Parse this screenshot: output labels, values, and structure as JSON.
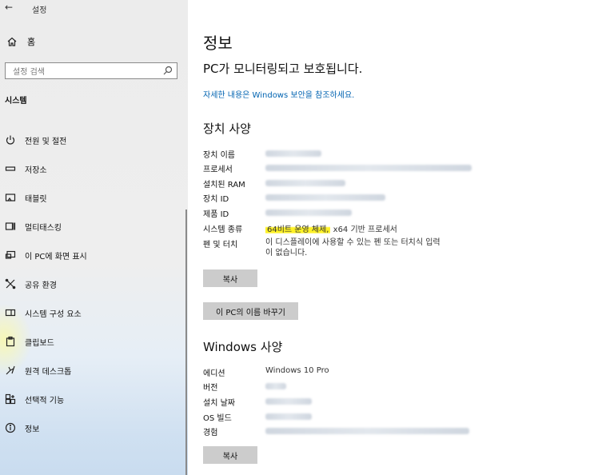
{
  "window": {
    "title": "설정",
    "back_icon": "back-arrow-icon"
  },
  "sidebar": {
    "home_label": "홈",
    "search_placeholder": "설정 검색",
    "section_title": "시스템",
    "items": [
      {
        "label": "전원 및 절전",
        "icon": "power-icon"
      },
      {
        "label": "저장소",
        "icon": "storage-icon"
      },
      {
        "label": "태블릿",
        "icon": "tablet-icon"
      },
      {
        "label": "멀티태스킹",
        "icon": "multitasking-icon"
      },
      {
        "label": "이 PC에 화면 표시",
        "icon": "project-icon"
      },
      {
        "label": "공유 환경",
        "icon": "shared-icon"
      },
      {
        "label": "시스템 구성 요소",
        "icon": "components-icon"
      },
      {
        "label": "클립보드",
        "icon": "clipboard-icon"
      },
      {
        "label": "원격 데스크톱",
        "icon": "remote-desktop-icon"
      },
      {
        "label": "선택적 기능",
        "icon": "optional-features-icon"
      },
      {
        "label": "정보",
        "icon": "info-icon"
      }
    ]
  },
  "main": {
    "title": "정보",
    "protection_status": "PC가 모니터링되고 보호됩니다.",
    "security_link": "자세한 내용은 Windows 보안을 참조하세요.",
    "device_specs": {
      "heading": "장치 사양",
      "rows": [
        {
          "label": "장치 이름",
          "value": "",
          "blurred": true
        },
        {
          "label": "프로세서",
          "value": "",
          "blurred": true
        },
        {
          "label": "설치된 RAM",
          "value": "",
          "blurred": true
        },
        {
          "label": "장치 ID",
          "value": "",
          "blurred": true
        },
        {
          "label": "제품 ID",
          "value": "",
          "blurred": true
        },
        {
          "label": "시스템 종류",
          "value_highlight": "64비트 운영 체제,",
          "value_rest": " x64 기반 프로세서"
        },
        {
          "label": "펜 및 터치",
          "value_line1": "이 디스플레이에 사용할 수 있는 펜 또는 터치식 입력",
          "value_line2": "이 없습니다."
        }
      ],
      "copy_button": "복사",
      "rename_button": "이 PC의 이름 바꾸기"
    },
    "windows_specs": {
      "heading": "Windows 사양",
      "rows": [
        {
          "label": "에디션",
          "value": "Windows 10 Pro"
        },
        {
          "label": "버전",
          "value": "",
          "blurred": true
        },
        {
          "label": "설치 날짜",
          "value": "",
          "blurred": true
        },
        {
          "label": "OS 빌드",
          "value": "",
          "blurred": true
        },
        {
          "label": "경험",
          "value": "",
          "blurred": true
        }
      ],
      "copy_button": "복사"
    }
  },
  "colors": {
    "link": "#0063b1",
    "highlight": "#fff000",
    "button_bg": "#cccccc"
  }
}
